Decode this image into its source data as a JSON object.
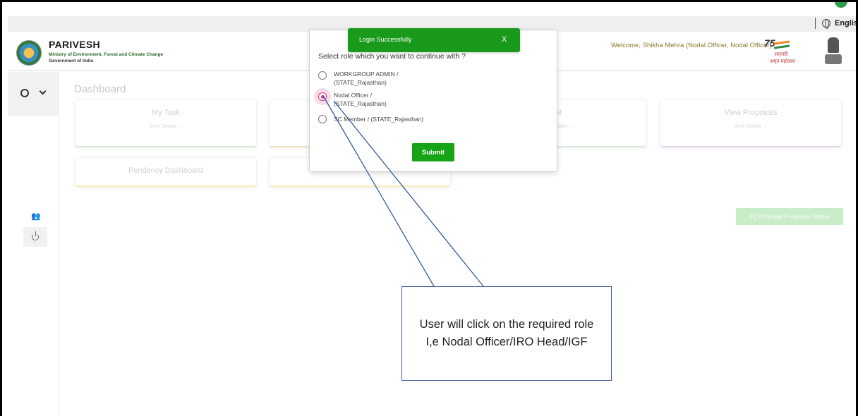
{
  "header": {
    "language": "English",
    "brand": "PARIVESH",
    "ministry": "Ministry of Environment, Forest and Climate Change",
    "government": "Government of India",
    "welcome": "Welcome, Shikha Mehra (Nodal Officer, Nodal Officer)",
    "azadi_line1": "आज़ादी",
    "azadi_line2": "अमृत महोत्सव",
    "azadi_number": "75"
  },
  "dashboard": {
    "title": "Dashboard",
    "cards": [
      {
        "title": "My Task",
        "link": "View Details →"
      },
      {
        "title": "",
        "link": ""
      },
      {
        "title": "M",
        "link": "etails →"
      },
      {
        "title": "View Proposals",
        "link": "View Details →"
      },
      {
        "title": "Pendency Dashboard",
        "link": ""
      },
      {
        "title": "",
        "link": ""
      }
    ],
    "fc_button": "FC Proposal Pendency Status"
  },
  "modal": {
    "title": "Select role which you want to continue with ?",
    "options": [
      {
        "line1": "WORKGROUP ADMIN /",
        "line2": "(STATE_Rajasthan)",
        "selected": false
      },
      {
        "line1": "Nodal Officer /",
        "line2": "(STATE_Rajasthan)",
        "selected": true
      },
      {
        "line1": "SC Member / (STATE_Rajasthan)",
        "line2": "",
        "selected": false
      }
    ],
    "submit_label": "Submit"
  },
  "toast": {
    "message": "Login Successfully",
    "close": "X"
  },
  "callout": {
    "text": "User will click on the required role I,e Nodal Officer/IRO Head/IGF"
  },
  "colors": {
    "accent_green": "#1a9a1a",
    "selected_radio": "#d63384",
    "callout_border": "#3a5a9a"
  }
}
